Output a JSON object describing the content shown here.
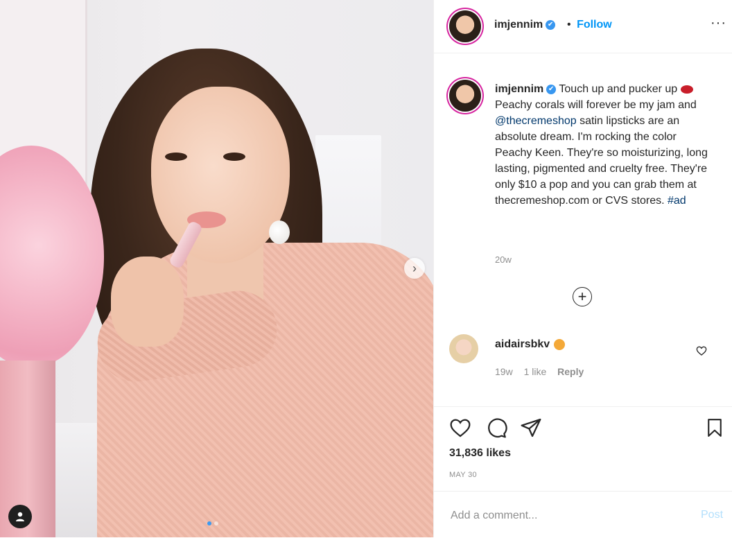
{
  "post": {
    "username": "imjennim",
    "verified_glyph": "✔",
    "separator": "•",
    "follow_label": "Follow",
    "more_label": "···",
    "caption": {
      "author": "imjennim",
      "part1": "Touch up and pucker up",
      "part2": "Peachy corals will forever be my jam and",
      "mention": "@thecremeshop",
      "part3": "satin lipsticks are an absolute dream. I'm rocking the color Peachy Keen. They're so moisturizing, long lasting, pigmented and cruelty free. They're only $10 a pop and you can grab them at thecremeshop.com or CVS stores.",
      "hashtag": "#ad",
      "emoji_icon": "lips-emoji-icon"
    },
    "caption_time": "20w",
    "load_more_glyph": "+",
    "comments": [
      {
        "username": "aidairsbkv",
        "emoji_icon": "heart-eyes-cat-emoji-icon",
        "time": "19w",
        "likes": "1 like",
        "reply_label": "Reply"
      }
    ],
    "likes": "31,836 likes",
    "date": "MAY 30",
    "add_comment_placeholder": "Add a comment...",
    "post_label": "Post",
    "carousel": {
      "count": 2,
      "active_index": 1
    },
    "next_arrow_glyph": "›"
  },
  "colors": {
    "accent": "#0095f6",
    "post_disabled": "#b2dffc",
    "muted_text": "#8e8e8e",
    "story_ring": "#d6249f"
  }
}
